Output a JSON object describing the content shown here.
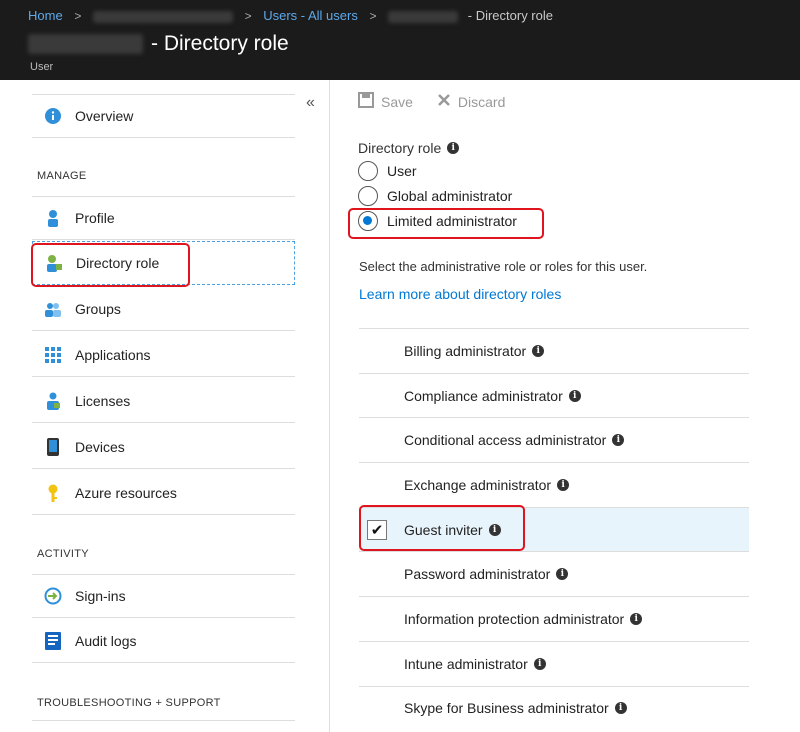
{
  "breadcrumb": {
    "home": "Home",
    "users": "Users - All users",
    "current": "- Directory role"
  },
  "header": {
    "title_suffix": "- Directory role",
    "subtitle": "User"
  },
  "nav": {
    "overview": "Overview",
    "manage_heading": "MANAGE",
    "profile": "Profile",
    "directory_role": "Directory role",
    "groups": "Groups",
    "applications": "Applications",
    "licenses": "Licenses",
    "devices": "Devices",
    "azure_resources": "Azure resources",
    "activity_heading": "ACTIVITY",
    "sign_ins": "Sign-ins",
    "audit_logs": "Audit logs",
    "troubleshooting_heading": "TROUBLESHOOTING + SUPPORT"
  },
  "toolbar": {
    "save": "Save",
    "discard": "Discard"
  },
  "directory_role": {
    "label": "Directory role",
    "options": [
      "User",
      "Global administrator",
      "Limited administrator"
    ],
    "selected": "Limited administrator",
    "select_text": "Select the administrative role or roles for this user.",
    "learn_more": "Learn more about directory roles"
  },
  "roles": [
    {
      "label": "Billing administrator",
      "checked": false
    },
    {
      "label": "Compliance administrator",
      "checked": false
    },
    {
      "label": "Conditional access administrator",
      "checked": false
    },
    {
      "label": "Exchange administrator",
      "checked": false
    },
    {
      "label": "Guest inviter",
      "checked": true
    },
    {
      "label": "Password administrator",
      "checked": false
    },
    {
      "label": "Information protection administrator",
      "checked": false
    },
    {
      "label": "Intune administrator",
      "checked": false
    },
    {
      "label": "Skype for Business administrator",
      "checked": false
    }
  ],
  "colors": {
    "header_bg": "#1b1b1b",
    "link": "#0078d4",
    "highlight": "#e0141f",
    "checked_row": "#e8f4fb"
  },
  "icons": {
    "info": "info-icon",
    "save": "save-icon",
    "discard": "discard-icon",
    "collapse": "collapse-chevron-icon"
  }
}
